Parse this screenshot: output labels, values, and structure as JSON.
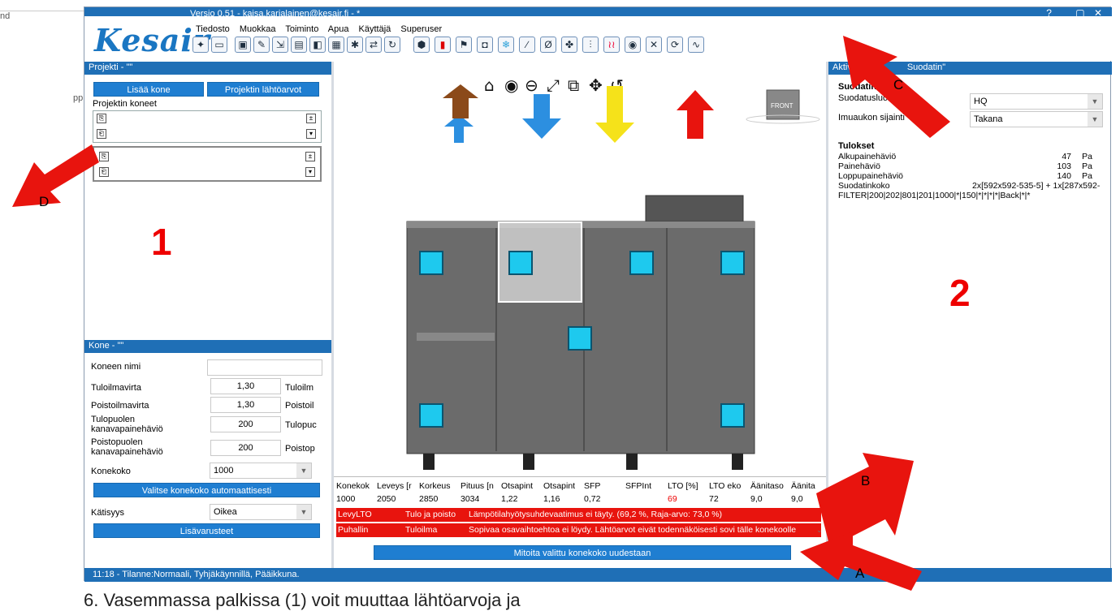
{
  "doc": {
    "cut_text_1": "nd",
    "cut_text_2": "ppl",
    "caption": "6. Vasemmassa palkissa (1) voit muuttaa lähtöarvoja ja"
  },
  "app": {
    "logo": "Kesair",
    "version": "Versio 0.51 - kaisa.karjalainen@kesair.fi - *",
    "window_controls": "? _ ▢ ✕",
    "menu": [
      "Tiedosto",
      "Muokkaa",
      "Toiminto",
      "Apua",
      "Käyttäjä",
      "Superuser"
    ],
    "toolbar_icons": [
      "new-icon",
      "open-icon",
      "save-icon",
      "save-as-icon",
      "export-icon",
      "report-icon",
      "pdf-icon",
      "print-icon",
      "settings-icon",
      "refresh-icon",
      "rotate-icon",
      "unit-icon",
      "damper-icon",
      "fan-icon",
      "coil-icon",
      "filter-icon",
      "heat-exchanger-icon",
      "measure-icon",
      "diameter-icon",
      "fan2-icon",
      "silencer-icon",
      "heater-icon",
      "eye-icon",
      "cross-icon",
      "cycle-icon",
      "sound-icon"
    ]
  },
  "project": {
    "header": "Projekti - \"\"",
    "add_machine": "Lisää kone",
    "defaults": "Projektin lähtöarvot",
    "machines_label": "Projektin koneet"
  },
  "machine": {
    "header": "Kone - \"\"",
    "fields": [
      {
        "label": "Koneen nimi",
        "value": "",
        "suffix": ""
      },
      {
        "label": "Tuloilmavirta",
        "value": "1,30",
        "suffix": "Tuloilm"
      },
      {
        "label": "Poistoilmavirta",
        "value": "1,30",
        "suffix": "Poistoil"
      },
      {
        "label": "Tulopuolen kanavapainehäviö",
        "value": "200",
        "suffix": "Tulopuc"
      },
      {
        "label": "Poistopuolen kanavapainehäviö",
        "value": "200",
        "suffix": "Poistop"
      }
    ],
    "size_label": "Konekoko",
    "size_value": "1000",
    "auto_size_btn": "Valitse konekoko automaattisesti",
    "handedness_label": "Kätisyys",
    "handedness_value": "Oikea",
    "accessories_btn": "Lisävarusteet"
  },
  "viewer": {
    "front_label": "FRONT"
  },
  "table": {
    "headers": [
      "Konekok",
      "Leveys [r",
      "Korkeus",
      "Pituus [n",
      "Otsapint",
      "Otsapint",
      "SFP",
      "SFPInt",
      "LTO [%]",
      "LTO eko",
      "Äänitaso",
      "Äänita"
    ],
    "values": [
      "1000",
      "2050",
      "2850",
      "3034",
      "1,22",
      "1,16",
      "0,72",
      "",
      "69",
      "72",
      "9,0",
      "9,0"
    ],
    "errors": [
      {
        "a": "LevyLTO",
        "b": "Tulo ja poisto",
        "c": "Lämpötilahyötysuhdevaatimus ei täyty. (69,2 %, Raja-arvo: 73,0 %)"
      },
      {
        "a": "Puhallin",
        "b": "Tuloilma",
        "c": "Sopivaa osavaihtoehtoa ei löydy. Lähtöarvot eivät todennäköisesti sovi tälle konekoolle"
      }
    ],
    "redimension_btn": "Mitoita valittu konekoko uudestaan",
    "lto_color": "#e00000"
  },
  "right": {
    "header": "Aktiv",
    "header_suffix": "Suodatin\"",
    "section": "Suodatin",
    "filter_class_label": "Suodatusluok",
    "filter_class_value": "HQ",
    "intake_label": "Imuaukon sijainti",
    "intake_value": "Takana",
    "results_title": "Tulokset",
    "results": [
      {
        "label": "Alkupainehäviö",
        "value": "47",
        "unit": "Pa"
      },
      {
        "label": "Painehäviö",
        "value": "103",
        "unit": "Pa"
      },
      {
        "label": "Loppupainehäviö",
        "value": "140",
        "unit": "Pa"
      }
    ],
    "filter_size_label": "Suodatinkoko",
    "filter_size_value": "2x[592x592-535-5] + 1x[287x592-",
    "filter_code": "FILTER|200|202|801|201|1000|*|150|*|*|*|*|Back|*|*"
  },
  "status": "11:18 - Tilanne:Normaali, Tyhjäkäynnillä, Pääikkuna.",
  "annotations": {
    "n1": "1",
    "n2": "2",
    "A": "A",
    "B": "B",
    "C": "C",
    "D": "D"
  }
}
